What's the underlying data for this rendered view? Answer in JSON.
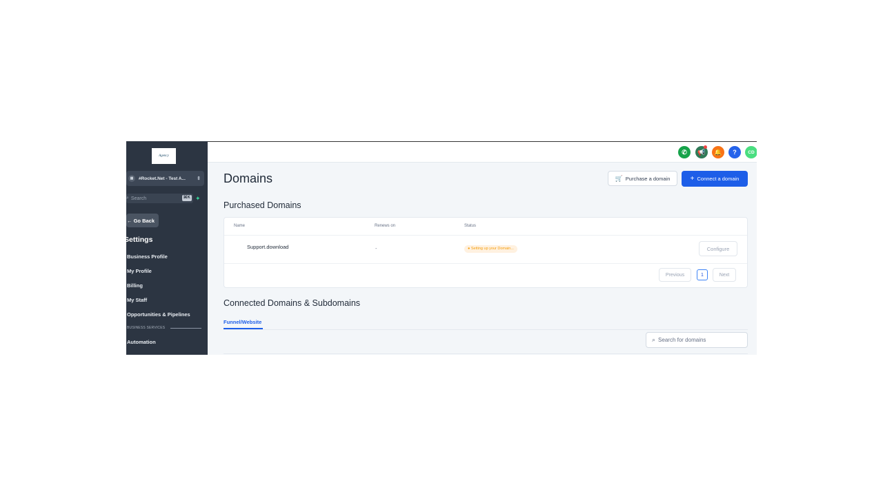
{
  "sidebar": {
    "logo_text": "Agency",
    "account_switcher": {
      "label": "#Rocket.Net - Test A...",
      "icon": "building-icon"
    },
    "search": {
      "placeholder": "Search",
      "shortcut": "⌘K"
    },
    "go_back": "← Go Back",
    "settings_title": "Settings",
    "items": [
      {
        "label": "Business Profile"
      },
      {
        "label": "My Profile"
      },
      {
        "label": "Billing"
      },
      {
        "label": "My Staff"
      },
      {
        "label": "Opportunities & Pipelines"
      }
    ],
    "section_label": "BUSINESS SERVICES",
    "items_after": [
      {
        "label": "Automation"
      }
    ]
  },
  "topbar": {
    "icons": [
      {
        "name": "phone-icon",
        "color": "#16a34a"
      },
      {
        "name": "megaphone-icon",
        "color": "#2f7a57"
      },
      {
        "name": "bell-icon",
        "color": "#f97316"
      },
      {
        "name": "help-icon",
        "color": "#2563eb",
        "glyph": "?"
      },
      {
        "name": "avatar",
        "color": "#4ade80",
        "initials": "CD"
      }
    ]
  },
  "main": {
    "title": "Domains",
    "purchase_button": "Purchase a domain",
    "connect_button": "Connect a domain",
    "purchased_heading": "Purchased Domains",
    "table": {
      "headers": [
        "Name",
        "Renews on",
        "Status"
      ],
      "rows": [
        {
          "name": "Support.download",
          "renews_on": "-",
          "status": "Setting up your Domain...",
          "action": "Configure"
        }
      ]
    },
    "pagination": {
      "previous": "Previous",
      "page": "1",
      "next": "Next"
    },
    "connected_heading": "Connected Domains & Subdomains",
    "tabs": [
      {
        "label": "Funnel/Website",
        "active": true
      }
    ],
    "search_placeholder": "Search for domains"
  },
  "colors": {
    "accent": "#1d5ee8",
    "sidebar_bg": "#2c3542",
    "status_pending": "#f59e0b"
  }
}
